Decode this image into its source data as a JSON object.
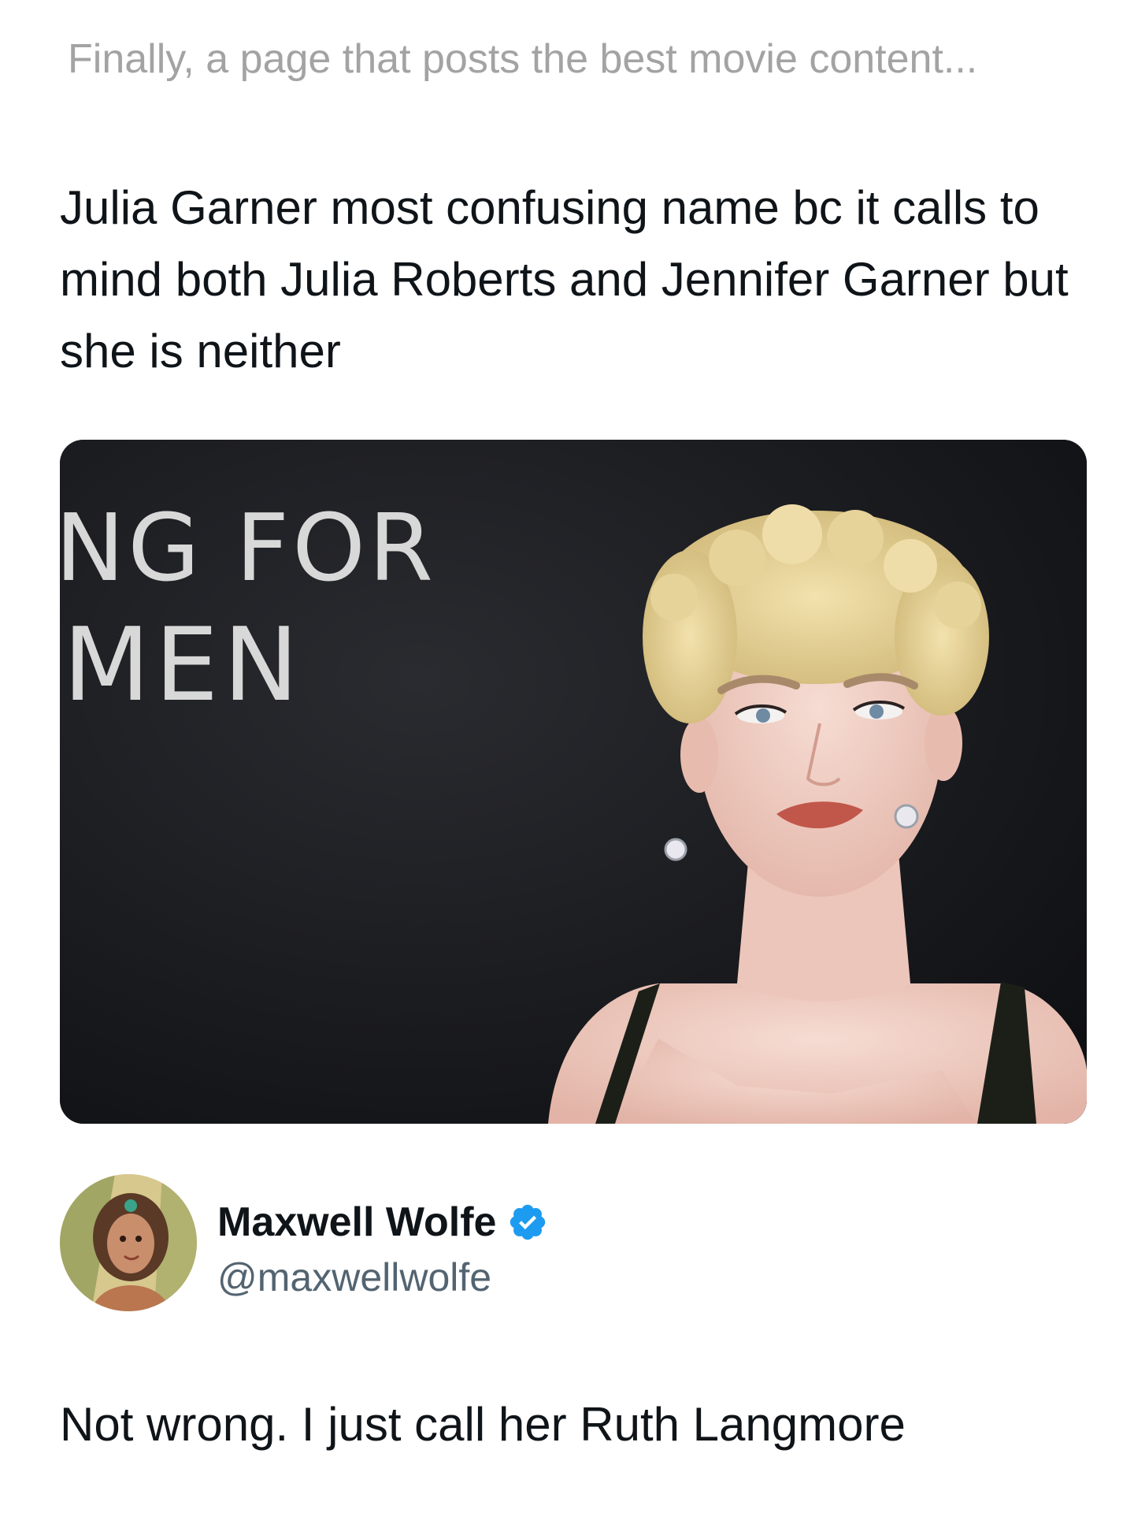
{
  "teaser": {
    "text": "Finally, a page that posts the best movie content..."
  },
  "post": {
    "text": "Julia Garner most confusing name bc it calls to mind both Julia Roberts and Jennifer Garner but she is neither",
    "media": {
      "backdrop_line_1": "NG FOR",
      "backdrop_line_2": "MEN"
    }
  },
  "author": {
    "name": "Maxwell Wolfe",
    "handle": "@maxwellwolfe",
    "verified": true,
    "verified_icon": "verified-badge-icon"
  },
  "reply": {
    "text": "Not wrong. I just call her Ruth Langmore"
  },
  "colors": {
    "teaser_gray": "#a3a3a3",
    "text_primary": "#0f1419",
    "text_secondary": "#536471",
    "verified_blue": "#1d9bf0",
    "photo_background": "#15161a"
  }
}
